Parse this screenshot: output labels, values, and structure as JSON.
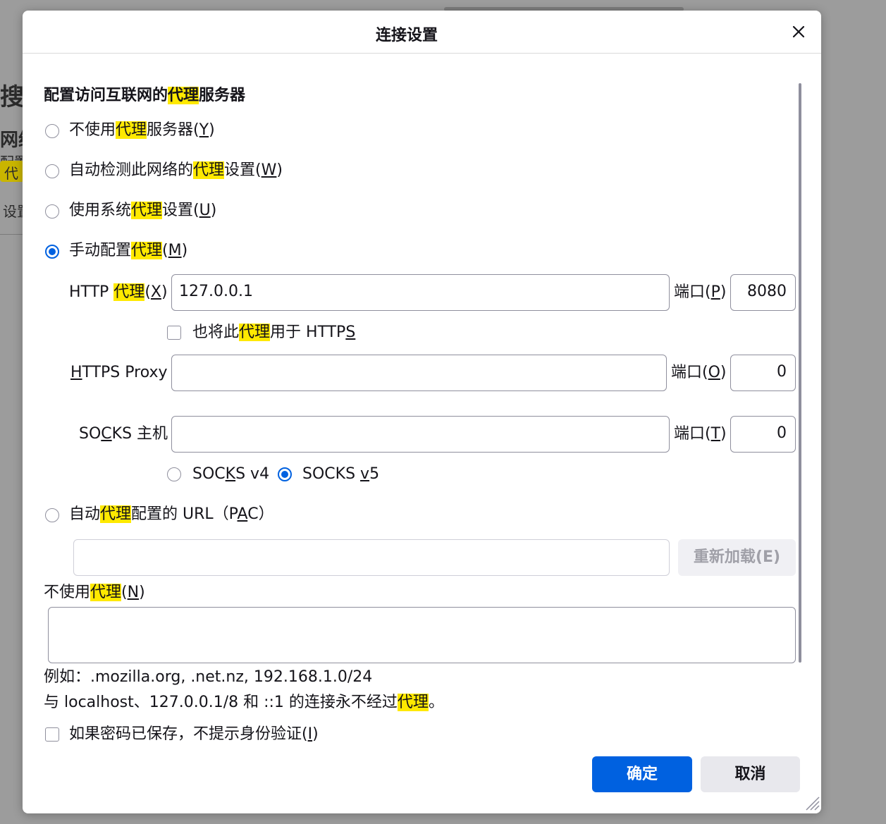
{
  "background": {
    "fragments": [
      "搜索",
      "网络",
      "配置",
      "代",
      "设置"
    ]
  },
  "dialog": {
    "title": "连接设置",
    "heading_prefix": "配置访问互联网的",
    "proxy_word": "代理",
    "heading_suffix": "服务器",
    "options": {
      "no_proxy": {
        "prefix": "不使用",
        "suffix": "服务器(",
        "key": "Y",
        "end": ")"
      },
      "auto_detect": {
        "prefix": "自动检测此网络的",
        "suffix": "设置(",
        "key": "W",
        "end": ")"
      },
      "system": {
        "prefix": "使用系统",
        "suffix": "设置(",
        "key": "U",
        "end": ")"
      },
      "manual": {
        "prefix": "手动配置",
        "suffix": "(",
        "key": "M",
        "end": ")"
      }
    },
    "selected_option": "manual",
    "http_proxy": {
      "label_prefix": "HTTP ",
      "label_suffix": "(",
      "key": "X",
      "end": ")",
      "value": "127.0.0.1",
      "port_label": "端口(",
      "port_key": "P",
      "port_end": ")",
      "port_value": "8080"
    },
    "also_https": {
      "prefix": "也将此",
      "suffix": "用于 HTTP",
      "key": "S",
      "checked": false
    },
    "https_proxy": {
      "label_key": "H",
      "label_rest": "TTPS Proxy",
      "value": "",
      "port_label": "端口(",
      "port_key": "O",
      "port_end": ")",
      "port_value": "0"
    },
    "socks": {
      "label_pre": "SO",
      "label_key": "C",
      "label_rest": "KS 主机",
      "value": "",
      "port_label": "端口(",
      "port_key": "T",
      "port_end": ")",
      "port_value": "0",
      "v4_pre": "SOC",
      "v4_key": "K",
      "v4_rest": "S v4",
      "v5_pre": "SOCKS ",
      "v5_key": "v",
      "v5_rest": "5",
      "selected_version": "v5"
    },
    "pac": {
      "prefix": "自动",
      "suffix": "配置的 URL（P",
      "key": "A",
      "end": "C）",
      "value": "",
      "reload_label": "重新加载(E)"
    },
    "no_proxy_for": {
      "prefix": "不使用",
      "suffix": "(",
      "key": "N",
      "end": ")",
      "value": "",
      "example": "例如：.mozilla.org, .net.nz, 192.168.1.0/24",
      "note_prefix": "与 localhost、127.0.0.1/8 和 ::1 的连接永不经过",
      "note_suffix": "。"
    },
    "auto_login": {
      "prefix": "如果密码已保存，不提示身份验证(",
      "key": "I",
      "end": ")",
      "checked": false
    },
    "ok_label": "确定",
    "cancel_label": "取消"
  }
}
